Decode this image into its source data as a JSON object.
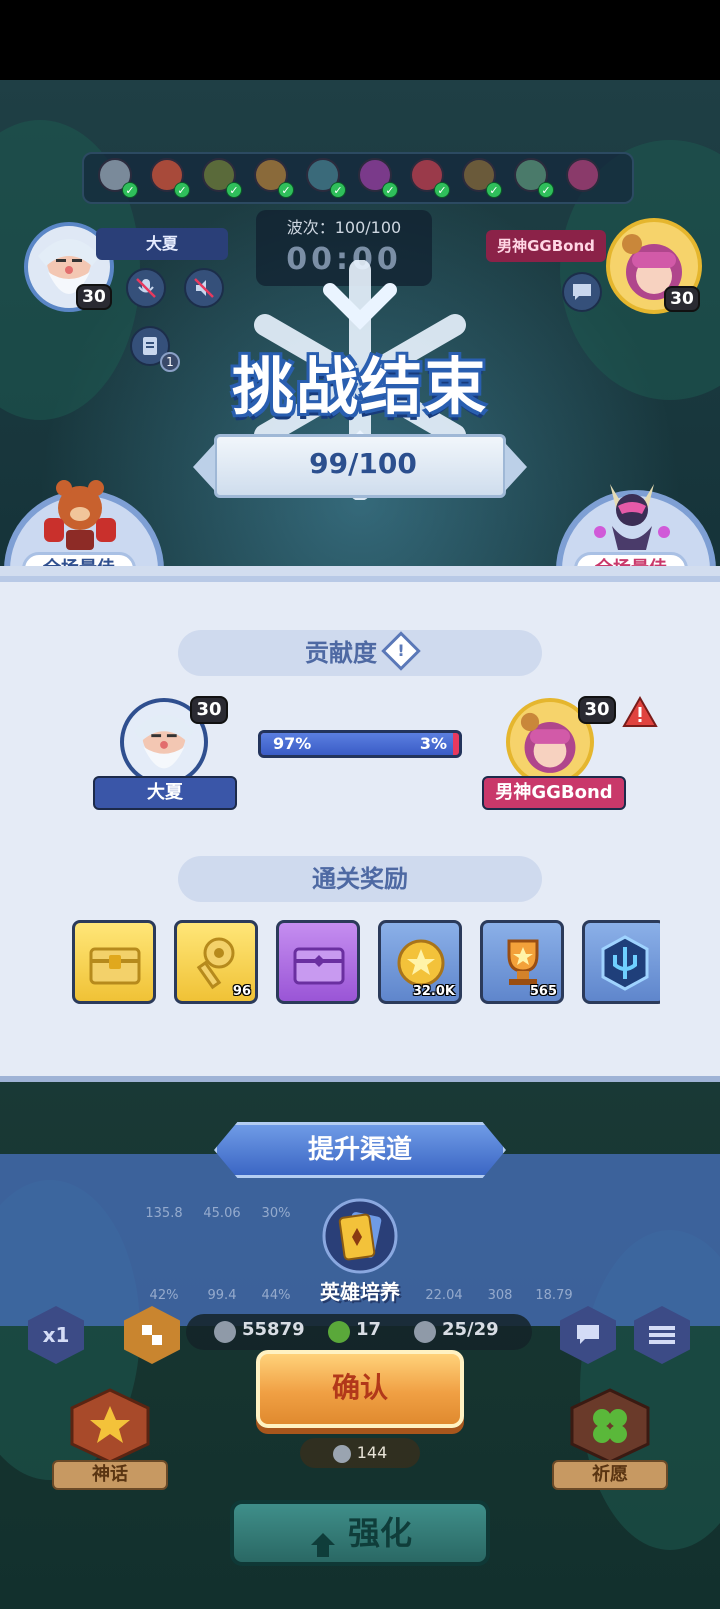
{
  "header": {
    "player_left_name": "大夏",
    "player_left_level": "30",
    "player_right_name": "男神GGBond",
    "player_right_level": "30",
    "wave_label": "波次：100/100",
    "timer": "00:00",
    "notif_count": "1"
  },
  "result": {
    "title": "挑战结束",
    "score": "99/100",
    "mvp_left_label": "全场最佳",
    "mvp_right_label": "全场最佳"
  },
  "contribution": {
    "header": "贡献度",
    "info_symbol": "!",
    "left_name": "大夏",
    "left_level": "30",
    "left_percent": "97%",
    "left_fraction": 0.97,
    "right_name": "男神GGBond",
    "right_level": "30",
    "right_percent": "3%"
  },
  "rewards": {
    "header": "通关奖励",
    "items": [
      {
        "name": "gold-chest",
        "count": ""
      },
      {
        "name": "gold-key",
        "count": "96"
      },
      {
        "name": "purple-chest",
        "count": ""
      },
      {
        "name": "gold-coin",
        "count": "32.0K"
      },
      {
        "name": "trophy",
        "count": "565"
      },
      {
        "name": "trident-emblem",
        "count": ""
      }
    ]
  },
  "boost": {
    "title": "提升渠道",
    "hero_training_label": "英雄培养",
    "stats_row1": [
      "135.8",
      "45.06",
      "30%"
    ],
    "stats_row2": [
      "42%",
      "99.4",
      "44%",
      "22.04",
      "308",
      "18.79"
    ]
  },
  "hud": {
    "speed_label": "x1",
    "coins": "55879",
    "clover": "17",
    "population": "25/29",
    "confirm_label": "确认",
    "cost": "144",
    "strengthen_label": "强化",
    "myth_label": "神话",
    "wish_label": "祈愿"
  },
  "colors": {
    "panel_bg": "#e5ebf6",
    "accent_blue": "#4e69a3",
    "confirm_orange": "#f0a044",
    "right_player_pink": "#c9386a"
  }
}
